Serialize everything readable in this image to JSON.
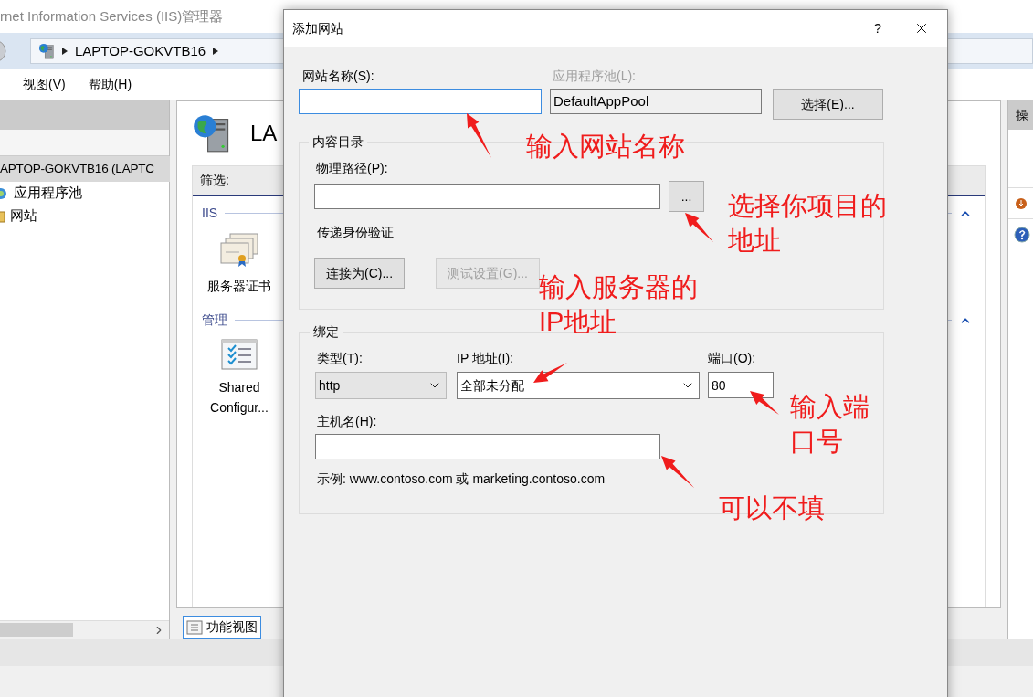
{
  "main_window": {
    "title": "rnet Information Services (IIS)管理器",
    "address": [
      "LAPTOP-GOKVTB16"
    ],
    "menu": [
      "视图(V)",
      "帮助(H)"
    ],
    "connections": [
      {
        "label": "APTOP-GOKVTB16 (LAPTC",
        "selected": true,
        "children": [
          {
            "label": "应用程序池",
            "kind": "pool",
            "selected": false
          },
          {
            "label": "网站",
            "kind": "sites",
            "selected": false
          }
        ]
      }
    ],
    "center": {
      "heading": "LA",
      "filter_label": "筛选:",
      "groups": [
        {
          "title": "IIS",
          "expanded": true,
          "features": [
            {
              "label": "服务器证书",
              "kind": "certificate"
            }
          ]
        },
        {
          "title": "管理",
          "expanded": true,
          "features": [
            {
              "label": "Shared Configur...",
              "kind": "config"
            }
          ]
        }
      ],
      "view_tab": {
        "label": "功能视图",
        "selected": true
      }
    },
    "actions": {
      "title": "操"
    }
  },
  "dialog": {
    "title": "添加网站",
    "help_button": "?",
    "site_name": {
      "label": "网站名称(S):",
      "focused": true
    },
    "app_pool": {
      "label": "应用程序池(L):",
      "value": "DefaultAppPool",
      "disabled": true
    },
    "select_button": "选择(E)...",
    "content_directory": {
      "title": "内容目录",
      "path_label": "物理路径(P):",
      "browse_button": "...",
      "auth_label": "传递身份验证",
      "buttons": [
        {
          "label": "连接为(C)...",
          "disabled": false
        },
        {
          "label": "测试设置(G)...",
          "disabled": true
        }
      ]
    },
    "binding": {
      "title": "绑定",
      "type": {
        "label": "类型(T):",
        "value": "http",
        "disabled": true
      },
      "ip": {
        "label": "IP 地址(I):",
        "value": "全部未分配"
      },
      "port": {
        "label": "端口(O):",
        "value": "80"
      },
      "host": {
        "label": "主机名(H):"
      },
      "example": "示例: www.contoso.com 或 marketing.contoso.com"
    }
  },
  "annotations": [
    {
      "lines": [
        "输入网站名称"
      ]
    },
    {
      "lines": [
        "选择你项目的",
        "地址"
      ]
    },
    {
      "lines": [
        "输入服务器的",
        "IP地址"
      ]
    },
    {
      "lines": [
        "输入端",
        "口号"
      ]
    },
    {
      "lines": [
        "可以不填"
      ]
    }
  ]
}
